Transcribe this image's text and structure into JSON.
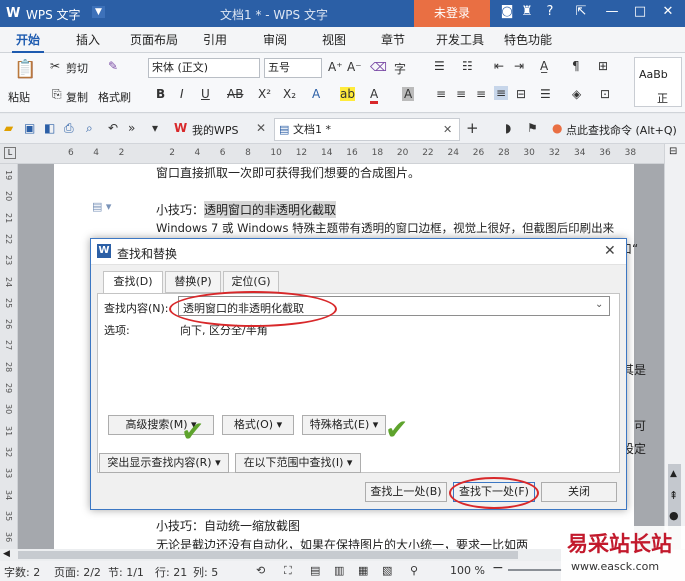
{
  "titlebar": {
    "logo": "W",
    "app": "WPS 文字",
    "document": "文档1 * - WPS 文字",
    "login": "未登录"
  },
  "tabs": [
    "开始",
    "插入",
    "页面布局",
    "引用",
    "审阅",
    "视图",
    "章节",
    "开发工具",
    "特色功能"
  ],
  "ribbon": {
    "paste": "粘贴",
    "cut": "剪切",
    "copy": "复制",
    "format_painter": "格式刷",
    "font_name": "宋体 (正文)",
    "font_size": "五号",
    "style_sample": "AaBb",
    "style_name": "正"
  },
  "quickbar": {
    "my_wps": "我的WPS",
    "doc_tab": "文档1 *",
    "search_cmd": "点此查找命令 (Alt+Q)"
  },
  "ruler": {
    "numbers": [
      "6",
      "4",
      "2",
      "",
      "2",
      "4",
      "6",
      "8",
      "10",
      "12",
      "14",
      "16",
      "18",
      "20",
      "22",
      "24",
      "26",
      "28",
      "30",
      "32",
      "34",
      "36",
      "38"
    ],
    "vnumbers": [
      "19",
      "20",
      "21",
      "22",
      "23",
      "24",
      "25",
      "26",
      "27",
      "28",
      "29",
      "30",
      "31",
      "32",
      "33",
      "34",
      "35",
      "36"
    ]
  },
  "document": {
    "line1": "窗口直接抓取一次即可获得我们想要的合成图片。",
    "tip1_prefix": "小技巧：",
    "tip1_highlight": "透明窗口的非透明化截取",
    "line3": "Windows 7 或 Windows 特殊主题带有透明的窗口边框，视觉上很好，但截图后印刷出来",
    "line4_tail": "口“",
    "right_frag1": "尤其是",
    "right_frag2": "定，可",
    "right_frag3": "，设定",
    "tip2": "小技巧：自动统一缩放截图",
    "line_last": "无论是截边还没有自动化，如果在保持图片的大小统一，要求一比如两"
  },
  "dialog": {
    "title": "查找和替换",
    "tabs": [
      "查找(D)",
      "替换(P)",
      "定位(G)"
    ],
    "find_label": "查找内容(N):",
    "find_value": "透明窗口的非透明化截取",
    "options_label": "选项:",
    "options_value": "向下, 区分全/半角",
    "btn_advanced": "高级搜索(M)",
    "btn_format": "格式(O)",
    "btn_special": "特殊格式(E)",
    "btn_highlight": "突出显示查找内容(R)",
    "btn_range": "在以下范围中查找(I)",
    "btn_prev": "查找上一处(B)",
    "btn_next": "查找下一处(F)",
    "btn_close": "关闭"
  },
  "status": {
    "words": "字数: 2",
    "page": "页面: 2/2",
    "section": "节: 1/1",
    "row": "行: 21",
    "col": "列: 5",
    "zoom": "100 %"
  },
  "watermark": {
    "text": "易采站长站",
    "url": "www.easck.com"
  },
  "colors": {
    "brand": "#2b5fa6",
    "login": "#e96f43",
    "annotation": "#d8282a",
    "check": "#5ea32d"
  }
}
